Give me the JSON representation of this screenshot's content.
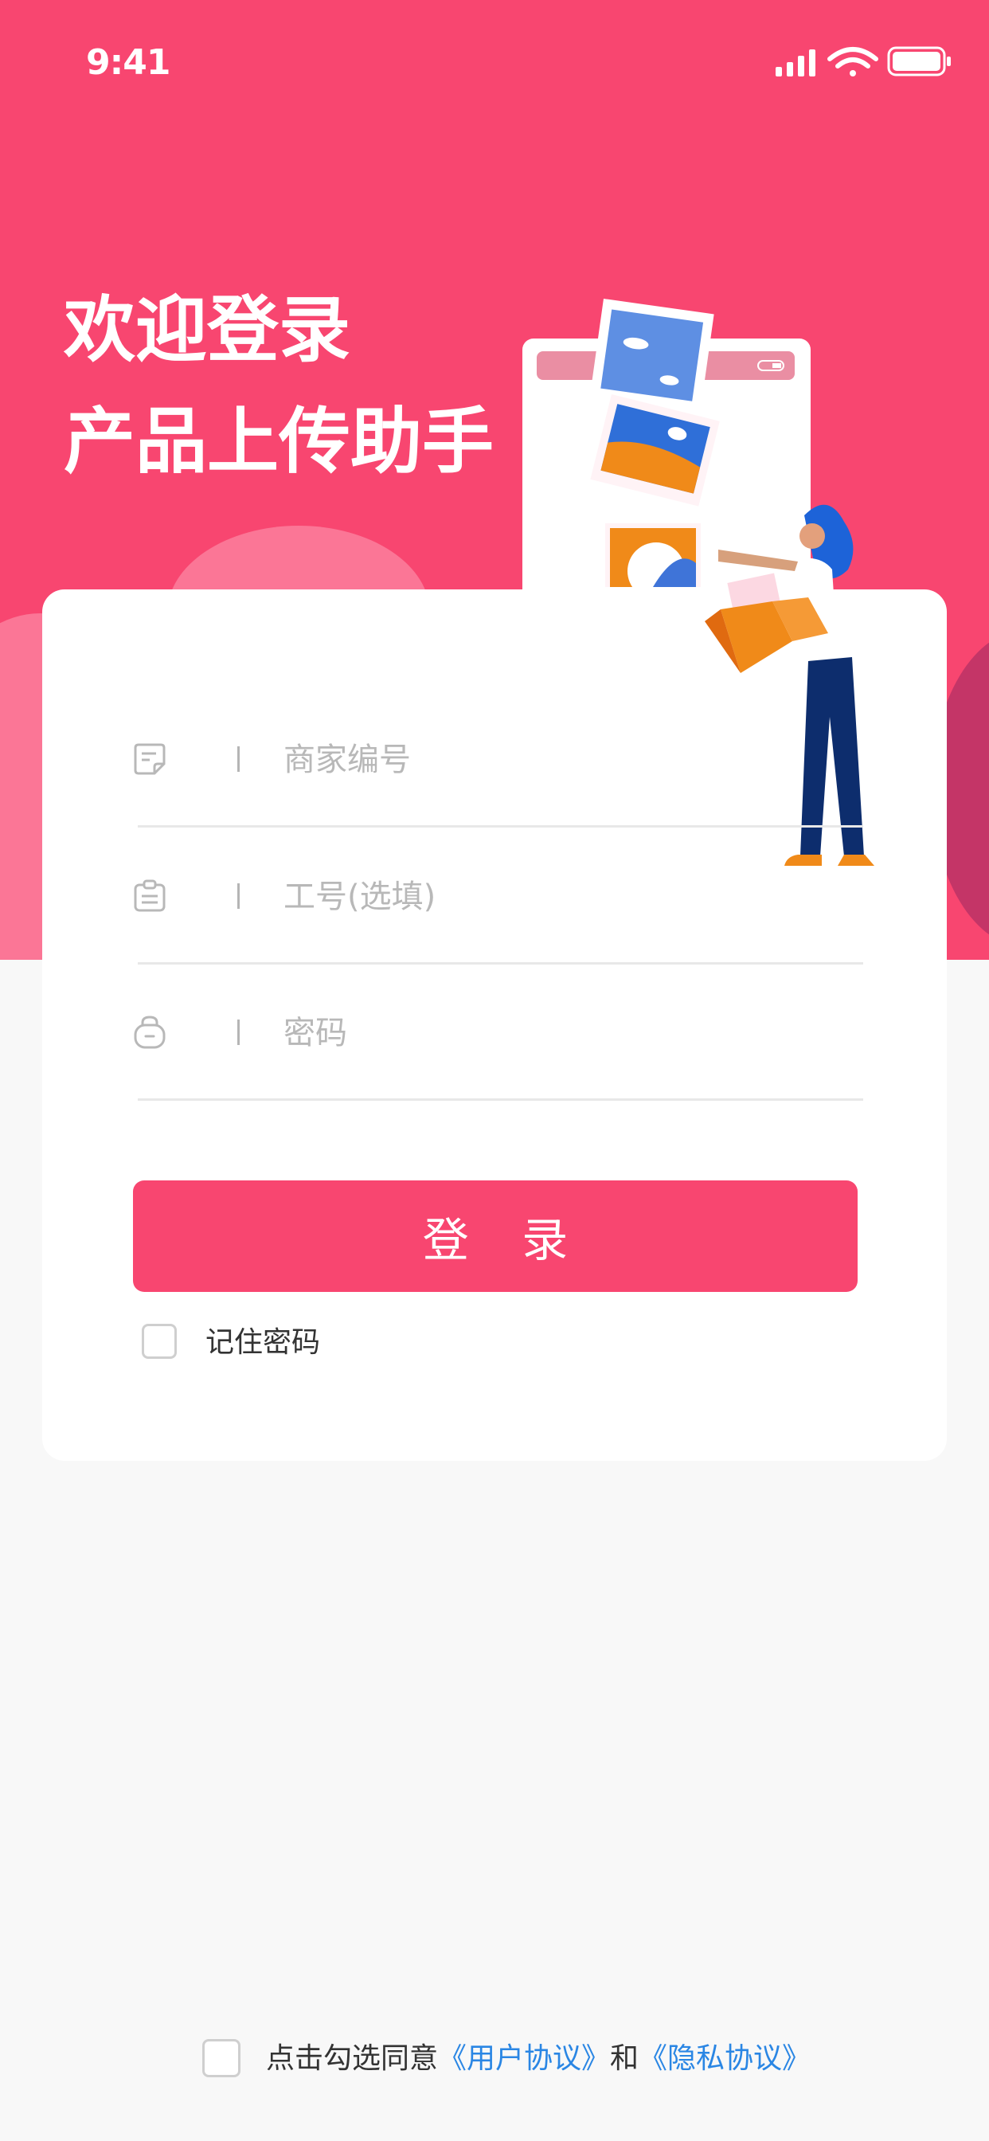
{
  "status_bar": {
    "time": "9:41"
  },
  "header": {
    "title_line1": "欢迎登录",
    "title_line2": "产品上传助手"
  },
  "form": {
    "merchant_id": {
      "icon": "merchant-note-icon",
      "placeholder": "商家编号",
      "value": ""
    },
    "employee_id": {
      "icon": "badge-icon",
      "placeholder": "工号(选填)",
      "value": ""
    },
    "password": {
      "icon": "lock-icon",
      "placeholder": "密码",
      "value": ""
    },
    "login_button": "登 录",
    "remember_label": "记住密码"
  },
  "agreement": {
    "prefix": "点击勾选同意",
    "user_agreement": "《用户协议》",
    "conjunction": "和",
    "privacy_policy": "《隐私协议》"
  },
  "colors": {
    "brand": "#f84670",
    "brand_light": "#fb7696",
    "link": "#2a86e4",
    "background": "#f8f8f8"
  }
}
